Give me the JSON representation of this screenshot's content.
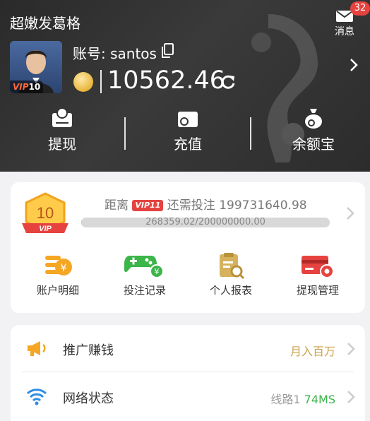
{
  "header": {
    "title": "超嫩发葛格",
    "messages": {
      "label": "消息",
      "count": "32"
    },
    "account_label": "账号: santos",
    "vip_tag": {
      "prefix": "VIP",
      "level": "10"
    },
    "balance": "10562.46",
    "actions": [
      {
        "label": "提现",
        "icon": "withdraw-icon"
      },
      {
        "label": "充值",
        "icon": "wallet-icon"
      },
      {
        "label": "余额宝",
        "icon": "money-bag-icon"
      }
    ]
  },
  "vip": {
    "badge_level": "10",
    "badge_text": "VIP",
    "distance_prefix": "距离",
    "next_level": "VIP11",
    "distance_suffix": "还需投注",
    "remaining": "199731640.98",
    "progress_text": "268359.02/200000000.00",
    "progress_fraction": 0.0013,
    "tools": [
      {
        "label": "账户明细",
        "icon": "account-detail-icon"
      },
      {
        "label": "投注记录",
        "icon": "gamepad-icon"
      },
      {
        "label": "个人报表",
        "icon": "report-icon"
      },
      {
        "label": "提现管理",
        "icon": "card-settings-icon"
      }
    ]
  },
  "menu": [
    {
      "label": "推广赚钱",
      "value": "月入百万",
      "icon": "megaphone-icon",
      "value_color": "#c9a24a"
    },
    {
      "label": "网络状态",
      "value_prefix": "线路1",
      "value": "74MS",
      "icon": "wifi-icon",
      "value_color": "#3cb54a"
    }
  ],
  "colors": {
    "accent_red": "#e64340",
    "gold": "#c9a24a",
    "green": "#3cb54a",
    "header_bg": "#2e2e2e"
  }
}
